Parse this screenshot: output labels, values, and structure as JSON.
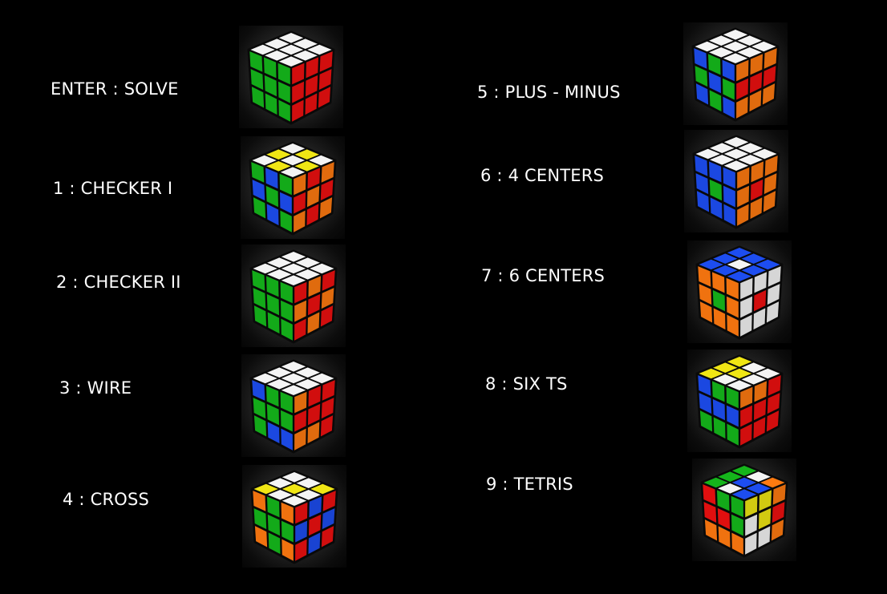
{
  "colors": {
    "W": "#f4f4f4",
    "G": "#15b51b",
    "R": "#ee1010",
    "B": "#1d4df0",
    "O": "#ff7a10",
    "Y": "#f0e614",
    "border": "#0a0a0a"
  },
  "patterns": [
    {
      "label": "ENTER : SOLVE",
      "top": [
        "W",
        "W",
        "W",
        "W",
        "W",
        "W",
        "W",
        "W",
        "W"
      ],
      "front": [
        "G",
        "G",
        "G",
        "G",
        "G",
        "G",
        "G",
        "G",
        "G"
      ],
      "right": [
        "R",
        "R",
        "R",
        "R",
        "R",
        "R",
        "R",
        "R",
        "R"
      ]
    },
    {
      "label": "1 : CHECKER I",
      "top": [
        "W",
        "Y",
        "W",
        "Y",
        "W",
        "Y",
        "W",
        "Y",
        "W"
      ],
      "front": [
        "G",
        "B",
        "G",
        "B",
        "G",
        "B",
        "G",
        "B",
        "G"
      ],
      "right": [
        "O",
        "R",
        "O",
        "R",
        "O",
        "R",
        "O",
        "R",
        "O"
      ]
    },
    {
      "label": "2 : CHECKER II",
      "top": [
        "W",
        "W",
        "W",
        "W",
        "W",
        "W",
        "W",
        "W",
        "W"
      ],
      "front": [
        "G",
        "G",
        "G",
        "G",
        "G",
        "G",
        "G",
        "G",
        "G"
      ],
      "right": [
        "R",
        "O",
        "R",
        "O",
        "R",
        "O",
        "R",
        "O",
        "R"
      ]
    },
    {
      "label": "3 : WIRE",
      "top": [
        "W",
        "W",
        "W",
        "W",
        "W",
        "W",
        "W",
        "W",
        "W"
      ],
      "front": [
        "B",
        "G",
        "G",
        "G",
        "G",
        "G",
        "G",
        "B",
        "B"
      ],
      "right": [
        "O",
        "R",
        "R",
        "R",
        "R",
        "R",
        "O",
        "O",
        "R"
      ]
    },
    {
      "label": "4 : CROSS",
      "top": [
        "Y",
        "W",
        "W",
        "W",
        "Y",
        "W",
        "W",
        "W",
        "Y"
      ],
      "front": [
        "O",
        "G",
        "O",
        "G",
        "G",
        "G",
        "O",
        "G",
        "O"
      ],
      "right": [
        "R",
        "B",
        "R",
        "B",
        "R",
        "B",
        "R",
        "B",
        "R"
      ]
    },
    {
      "label": "5 : PLUS - MINUS",
      "top": [
        "W",
        "W",
        "W",
        "W",
        "W",
        "W",
        "W",
        "W",
        "W"
      ],
      "front": [
        "B",
        "G",
        "B",
        "G",
        "B",
        "G",
        "B",
        "G",
        "B"
      ],
      "right": [
        "O",
        "O",
        "O",
        "R",
        "R",
        "R",
        "O",
        "O",
        "O"
      ]
    },
    {
      "label": "6 : 4 CENTERS",
      "top": [
        "W",
        "W",
        "W",
        "W",
        "W",
        "W",
        "W",
        "W",
        "W"
      ],
      "front": [
        "B",
        "B",
        "B",
        "B",
        "G",
        "B",
        "B",
        "B",
        "B"
      ],
      "right": [
        "O",
        "O",
        "O",
        "O",
        "R",
        "O",
        "O",
        "O",
        "O"
      ]
    },
    {
      "label": "7 : 6 CENTERS",
      "top": [
        "B",
        "B",
        "B",
        "B",
        "W",
        "B",
        "B",
        "B",
        "B"
      ],
      "front": [
        "O",
        "O",
        "O",
        "O",
        "G",
        "O",
        "O",
        "O",
        "O"
      ],
      "right": [
        "W",
        "W",
        "W",
        "W",
        "R",
        "W",
        "W",
        "W",
        "W"
      ]
    },
    {
      "label": "8 : SIX TS",
      "top": [
        "Y",
        "Y",
        "Y",
        "W",
        "Y",
        "W",
        "W",
        "W",
        "W"
      ],
      "front": [
        "B",
        "G",
        "G",
        "B",
        "B",
        "B",
        "G",
        "G",
        "G"
      ],
      "right": [
        "O",
        "O",
        "R",
        "R",
        "R",
        "R",
        "R",
        "R",
        "R"
      ]
    },
    {
      "label": "9 : TETRIS",
      "top": [
        "G",
        "G",
        "G",
        "W",
        "B",
        "W",
        "B",
        "B",
        "O"
      ],
      "front": [
        "R",
        "G",
        "G",
        "R",
        "R",
        "G",
        "O",
        "O",
        "O"
      ],
      "right": [
        "Y",
        "Y",
        "O",
        "W",
        "Y",
        "R",
        "W",
        "W",
        "O"
      ]
    }
  ]
}
